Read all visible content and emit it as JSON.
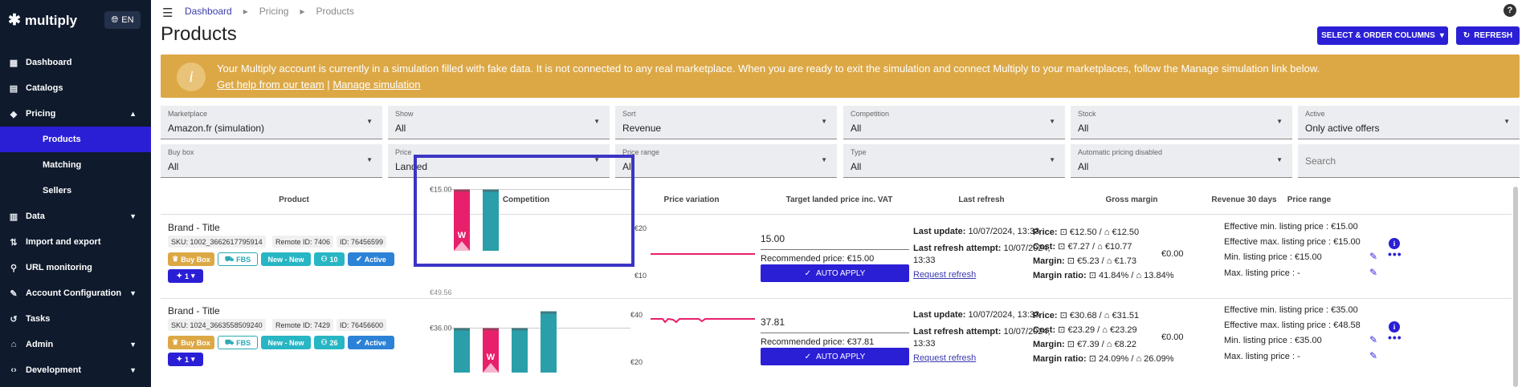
{
  "app": {
    "logo": "multiply",
    "lang": "EN"
  },
  "sidebar": {
    "items": [
      {
        "label": "Dashboard",
        "icon": "dashboard-icon"
      },
      {
        "label": "Catalogs",
        "icon": "catalogs-icon"
      },
      {
        "label": "Pricing",
        "icon": "pricing-tag-icon",
        "expanded": true
      },
      {
        "label": "Products",
        "sub": true,
        "active": true
      },
      {
        "label": "Matching",
        "sub": true
      },
      {
        "label": "Sellers",
        "sub": true
      },
      {
        "label": "Data",
        "icon": "data-icon"
      },
      {
        "label": "Import and export",
        "icon": "import-export-icon"
      },
      {
        "label": "URL monitoring",
        "icon": "link-icon"
      },
      {
        "label": "Account Configuration",
        "icon": "wrench-icon"
      },
      {
        "label": "Tasks",
        "icon": "history-icon"
      },
      {
        "label": "Admin",
        "icon": "bank-icon"
      },
      {
        "label": "Development",
        "icon": "code-icon"
      }
    ]
  },
  "breadcrumb": [
    "Dashboard",
    "Pricing",
    "Products"
  ],
  "page": {
    "title": "Products",
    "select_columns": "SELECT & ORDER COLUMNS",
    "refresh": "REFRESH"
  },
  "banner": {
    "message": "Your Multiply account is currently in a simulation filled with fake data. It is not connected to any real marketplace. When you are ready to exit the simulation and connect Multiply to your marketplaces, follow the Manage simulation link below.",
    "help_link": "Get help from our team",
    "separator": "|",
    "manage_link": "Manage simulation"
  },
  "filters": [
    {
      "label": "Marketplace",
      "value": "Amazon.fr (simulation)"
    },
    {
      "label": "Show",
      "value": "All"
    },
    {
      "label": "Sort",
      "value": "Revenue"
    },
    {
      "label": "Competition",
      "value": "All"
    },
    {
      "label": "Stock",
      "value": "All"
    },
    {
      "label": "Active",
      "value": "Only active offers"
    },
    {
      "label": "Buy box",
      "value": "All"
    },
    {
      "label": "Price",
      "value": "Landed"
    },
    {
      "label": "Price range",
      "value": "All"
    },
    {
      "label": "Type",
      "value": "All"
    },
    {
      "label": "Automatic pricing disabled",
      "value": "All"
    },
    {
      "label": "",
      "value": "",
      "placeholder": "Search"
    }
  ],
  "columns": [
    "Product",
    "Competition",
    "Price variation",
    "Target landed price inc. VAT",
    "Last refresh",
    "Gross margin",
    "Revenue 30 days",
    "Price range"
  ],
  "rows": [
    {
      "title": "Brand - Title",
      "sku": "SKU: 1002_3662617795914",
      "remote_id": "Remote ID: 7406",
      "id": "ID: 76456599",
      "tags": {
        "buy_box": "Buy Box",
        "fbs": "FBS",
        "new": "New - New",
        "count": "10",
        "active": "Active",
        "variants": "1"
      },
      "chart": {
        "price_label": "€15.00",
        "bars": [
          {
            "color": "#e8206b",
            "value": 15,
            "winner": true
          },
          {
            "color": "#2a9faa",
            "value": 15,
            "winner": false
          }
        ],
        "winner_mark": "W"
      },
      "variation": {
        "top": "€20",
        "bottom": "€10"
      },
      "target": "15.00",
      "recommended": "Recommended price: €15.00",
      "auto_apply": "AUTO APPLY",
      "last_update_label": "Last update:",
      "last_update": "10/07/2024, 13:33",
      "last_attempt_label": "Last refresh attempt:",
      "last_attempt": "10/07/2024,",
      "last_attempt_time": "13:33",
      "request_refresh": "Request refresh",
      "margin": {
        "price_label": "Price:",
        "price": "€12.50 / ",
        "price2": "€12.50",
        "cost_label": "Cost:",
        "cost": "€7.27 / ",
        "cost2": "€10.77",
        "margin_label": "Margin:",
        "margin": "€5.23 / ",
        "margin2": "€1.73",
        "ratio_label": "Margin ratio:",
        "ratio": "41.84% / ",
        "ratio2": "13.84%"
      },
      "revenue": "€0.00",
      "range": {
        "eff_min_label": "Effective min. listing price :",
        "eff_min": "€15.00",
        "eff_max_label": "Effective max. listing price :",
        "eff_max": "€15.00",
        "min_label": "Min. listing price :",
        "min": "€15.00",
        "max_label": "Max. listing price :",
        "max": "-"
      }
    },
    {
      "title": "Brand - Title",
      "sku": "SKU: 1024_3663558509240",
      "remote_id": "Remote ID: 7429",
      "id": "ID: 76456600",
      "tags": {
        "buy_box": "Buy Box",
        "fbs": "FBS",
        "new": "New - New",
        "count": "26",
        "active": "Active",
        "variants": "1"
      },
      "chart": {
        "price_label": "€36.00",
        "price_label_top": "€49.56",
        "bars": [
          {
            "color": "#2a9faa",
            "value": 36,
            "winner": false
          },
          {
            "color": "#e8206b",
            "value": 36,
            "winner": true
          },
          {
            "color": "#2a9faa",
            "value": 36,
            "winner": false
          },
          {
            "color": "#2a9faa",
            "value": 49.56,
            "winner": false
          }
        ],
        "winner_mark": "W"
      },
      "variation": {
        "top": "€40",
        "bottom": "€20"
      },
      "target": "37.81",
      "recommended": "Recommended price: €37.81",
      "auto_apply": "AUTO APPLY",
      "last_update_label": "Last update:",
      "last_update": "10/07/2024, 13:33",
      "last_attempt_label": "Last refresh attempt:",
      "last_attempt": "10/07/2024,",
      "last_attempt_time": "13:33",
      "request_refresh": "Request refresh",
      "margin": {
        "price_label": "Price:",
        "price": "€30.68 / ",
        "price2": "€31.51",
        "cost_label": "Cost:",
        "cost": "€23.29 / ",
        "cost2": "€23.29",
        "margin_label": "Margin:",
        "margin": "€7.39 / ",
        "margin2": "€8.22",
        "ratio_label": "Margin ratio:",
        "ratio": "24.09% / ",
        "ratio2": "26.09%"
      },
      "revenue": "€0.00",
      "range": {
        "eff_min_label": "Effective min. listing price :",
        "eff_min": "€35.00",
        "eff_max_label": "Effective max. listing price :",
        "eff_max": "€48.58",
        "min_label": "Min. listing price :",
        "min": "€35.00",
        "max_label": "Max. listing price :",
        "max": "-"
      }
    }
  ],
  "colors": {
    "accent": "#2b1fd6",
    "sidebar": "#0f1a2c",
    "banner": "#dca846",
    "buybox": "#e8206b",
    "competitor": "#2a9faa"
  }
}
